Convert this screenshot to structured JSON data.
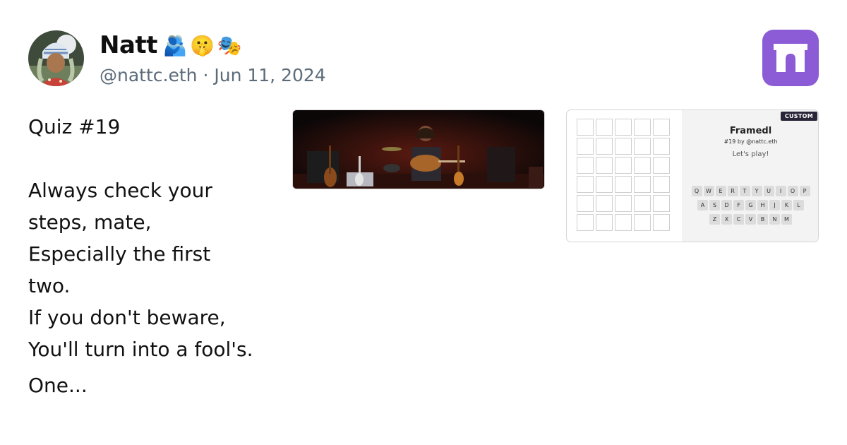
{
  "author": {
    "name": "Natt",
    "handle": "@nattc.eth",
    "separator": "·",
    "date": "Jun 11, 2024",
    "name_emojis": [
      "🫂",
      "🤫",
      "🎭"
    ]
  },
  "post": {
    "title": "Quiz #19",
    "body": "Always check your\nsteps, mate,\nEspecially the first\ntwo.\nIf you don't beware,\nYou'll turn into a fool's.",
    "more": "One..."
  },
  "frame": {
    "badge": "CUSTOM",
    "title": "Framedl",
    "subtitle": "#19 by @nattc.eth",
    "prompt": "Let's play!",
    "keyboard_rows": [
      [
        "Q",
        "W",
        "E",
        "R",
        "T",
        "Y",
        "U",
        "I",
        "O",
        "P"
      ],
      [
        "A",
        "S",
        "D",
        "F",
        "G",
        "H",
        "J",
        "K",
        "L"
      ],
      [
        "Z",
        "X",
        "C",
        "V",
        "B",
        "N",
        "M"
      ]
    ]
  },
  "colors": {
    "handle": "#5b6b7a",
    "app_logo": "#8b5cd6",
    "badge": "#2a2438"
  },
  "icons": {
    "app_logo": "arch-logo-icon",
    "avatar": "user-avatar"
  }
}
